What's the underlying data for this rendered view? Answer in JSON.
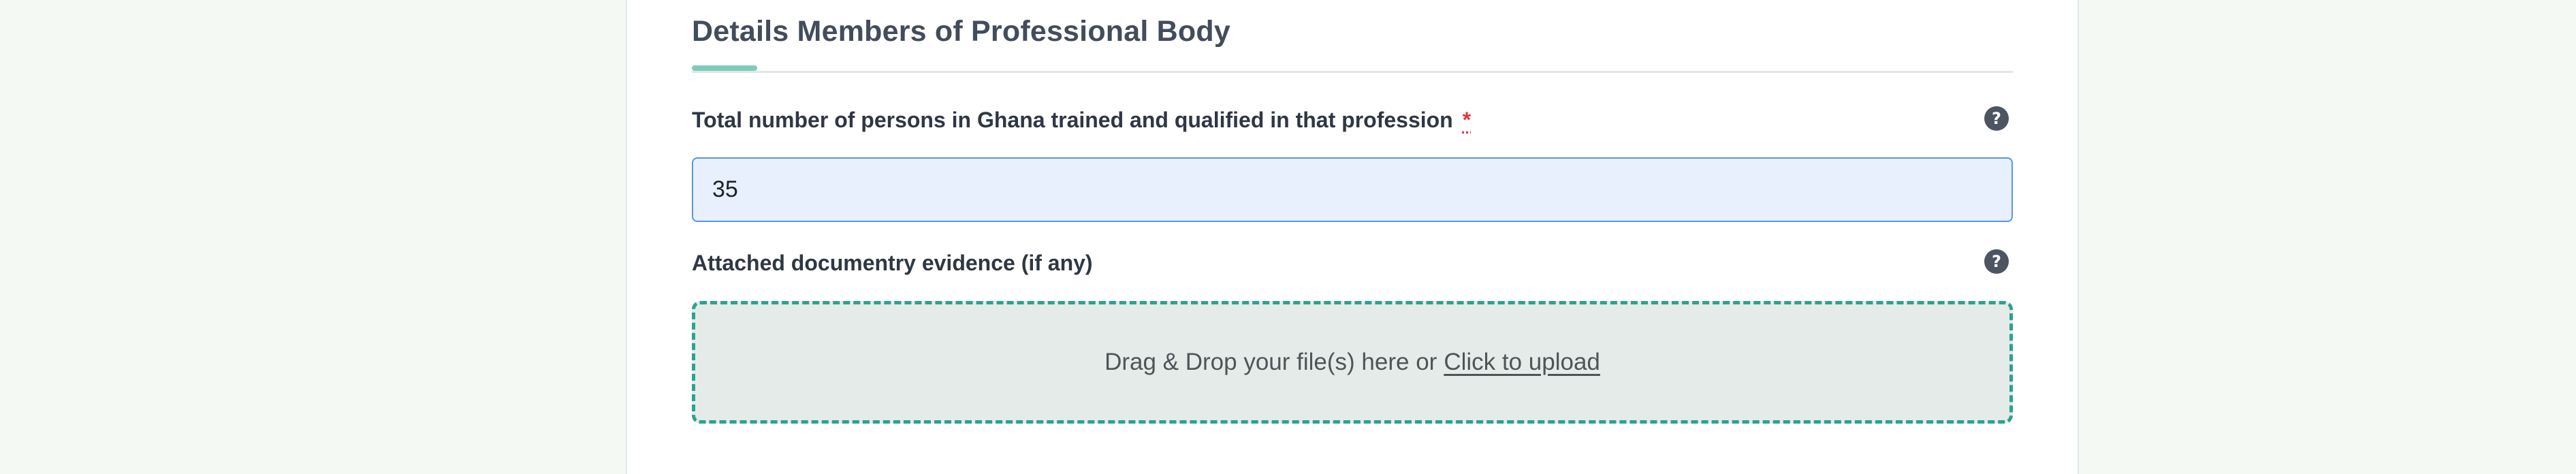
{
  "section": {
    "title": "Details Members of Professional Body"
  },
  "fields": {
    "total_persons": {
      "label": "Total number of persons in Ghana trained and qualified in that profession",
      "required_marker": "*",
      "value": "35",
      "help_glyph": "?"
    },
    "evidence": {
      "label": "Attached documentry evidence (if any)",
      "help_glyph": "?",
      "dropzone_text": "Drag & Drop your file(s) here or",
      "dropzone_link": "Click to upload"
    }
  },
  "icons": {
    "help": "question-circle-icon"
  },
  "colors": {
    "accent": "#7ecbbb",
    "dropzone_border": "#2aa38e",
    "input_border": "#5a95e8",
    "input_fill": "#e8f0fe",
    "required": "#e0373f"
  }
}
